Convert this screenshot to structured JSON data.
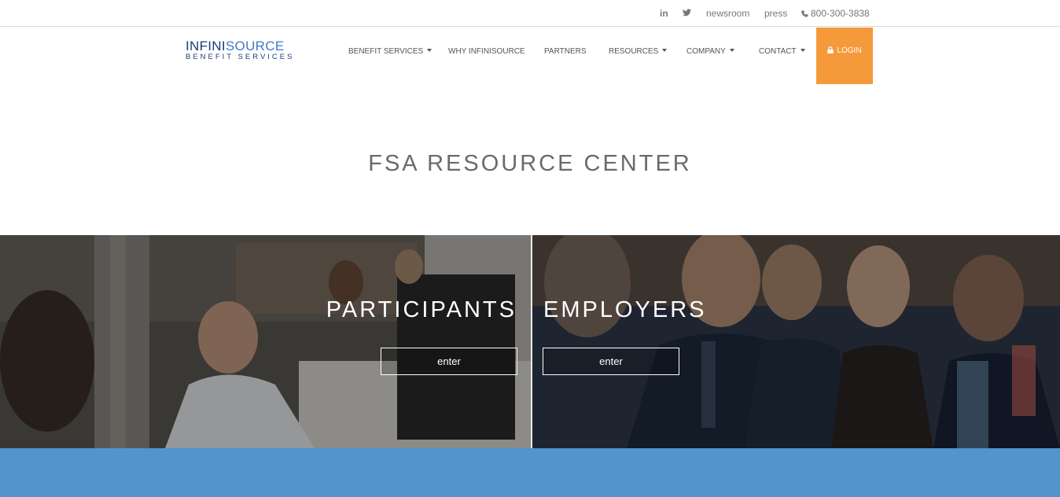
{
  "topbar": {
    "linkedin_label": "in",
    "twitter_icon": "twitter-icon",
    "newsroom": "newsroom",
    "press": "press",
    "phone": "800-300-3838"
  },
  "logo": {
    "line1_a": "INFINI",
    "line1_b": "SOURCE",
    "line2": "BENEFIT SERVICES",
    "colors": {
      "dark": "#1f3c78",
      "accent": "#3d7cc9"
    }
  },
  "nav": {
    "benefit_services": "BENEFIT SERVICES",
    "why": "WHY INFINISOURCE",
    "partners": "PARTNERS",
    "resources": "RESOURCES",
    "company": "COMPANY",
    "contact": "CONTACT",
    "login": "LOGIN",
    "login_color": "#f59a3b"
  },
  "page": {
    "title": "FSA RESOURCE CENTER"
  },
  "hero": {
    "participants": {
      "heading": "PARTICIPANTS",
      "button": "enter"
    },
    "employers": {
      "heading": "EMPLOYERS",
      "button": "enter"
    }
  },
  "colors": {
    "band": "#5294cb"
  }
}
